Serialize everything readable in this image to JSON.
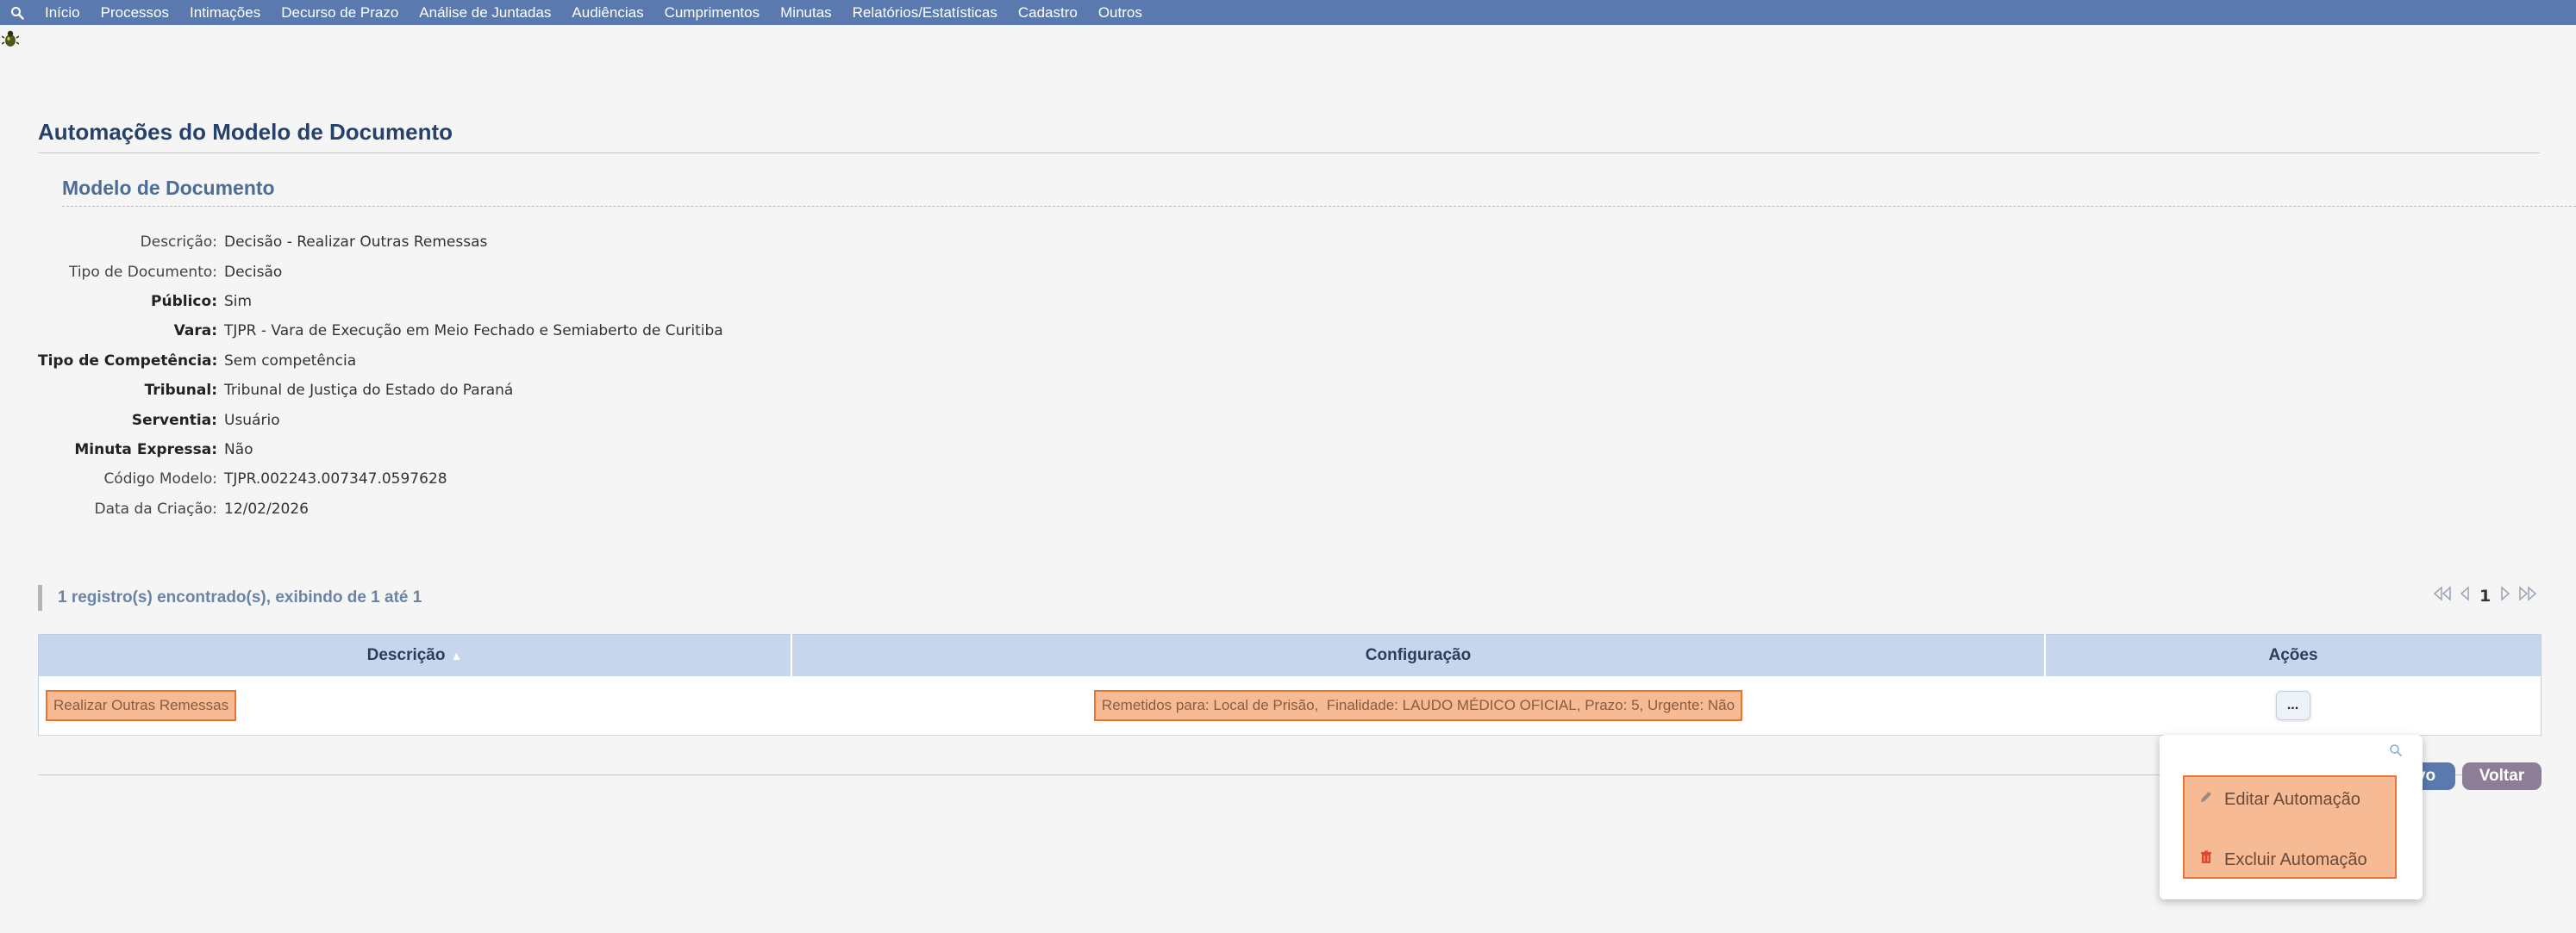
{
  "nav": {
    "items": [
      "Início",
      "Processos",
      "Intimações",
      "Decurso de Prazo",
      "Análise de Juntadas",
      "Audiências",
      "Cumprimentos",
      "Minutas",
      "Relatórios/Estatísticas",
      "Cadastro",
      "Outros"
    ]
  },
  "page": {
    "title": "Automações do Modelo de Documento",
    "section_title": "Modelo de Documento"
  },
  "fields": [
    {
      "label": "Descrição:",
      "value": "Decisão - Realizar Outras Remessas",
      "bold": false
    },
    {
      "label": "Tipo de Documento:",
      "value": "Decisão",
      "bold": false
    },
    {
      "label": "Público:",
      "value": "Sim",
      "bold": true
    },
    {
      "label": "Vara:",
      "value": "TJPR - Vara de Execução em Meio Fechado e Semiaberto de Curitiba",
      "bold": true
    },
    {
      "label": "Tipo de Competência:",
      "value": "Sem competência",
      "bold": true
    },
    {
      "label": "Tribunal:",
      "value": "Tribunal de Justiça do Estado do Paraná",
      "bold": true
    },
    {
      "label": "Serventia:",
      "value": "Usuário",
      "bold": true
    },
    {
      "label": "Minuta Expressa:",
      "value": "Não",
      "bold": true
    },
    {
      "label": "Código Modelo:",
      "value": "TJPR.002243.007347.0597628",
      "bold": false
    },
    {
      "label": "Data da Criação:",
      "value": "12/02/2026",
      "bold": false
    }
  ],
  "records_text": "1 registro(s) encontrado(s), exibindo de 1 até 1",
  "pager": {
    "current": "1"
  },
  "table": {
    "headers": {
      "descricao": "Descrição",
      "configuracao": "Configuração",
      "acoes": "Ações"
    },
    "rows": [
      {
        "descricao": "Realizar Outras Remessas",
        "config_part1": "Remetidos para: Local de Prisão,",
        "config_part2": "Finalidade: LAUDO MÉDICO OFICIAL, Prazo: 5, Urgente: Não",
        "actions_label": "..."
      }
    ]
  },
  "buttons": {
    "novo": "vo",
    "voltar": "Voltar"
  },
  "dropdown": {
    "edit": "Editar Automação",
    "delete": "Excluir Automação"
  },
  "colors": {
    "nav": "#5a7aaf",
    "highlight": "#f6bb95",
    "highlight_border": "#e9752f",
    "header": "#c6d6ec"
  }
}
